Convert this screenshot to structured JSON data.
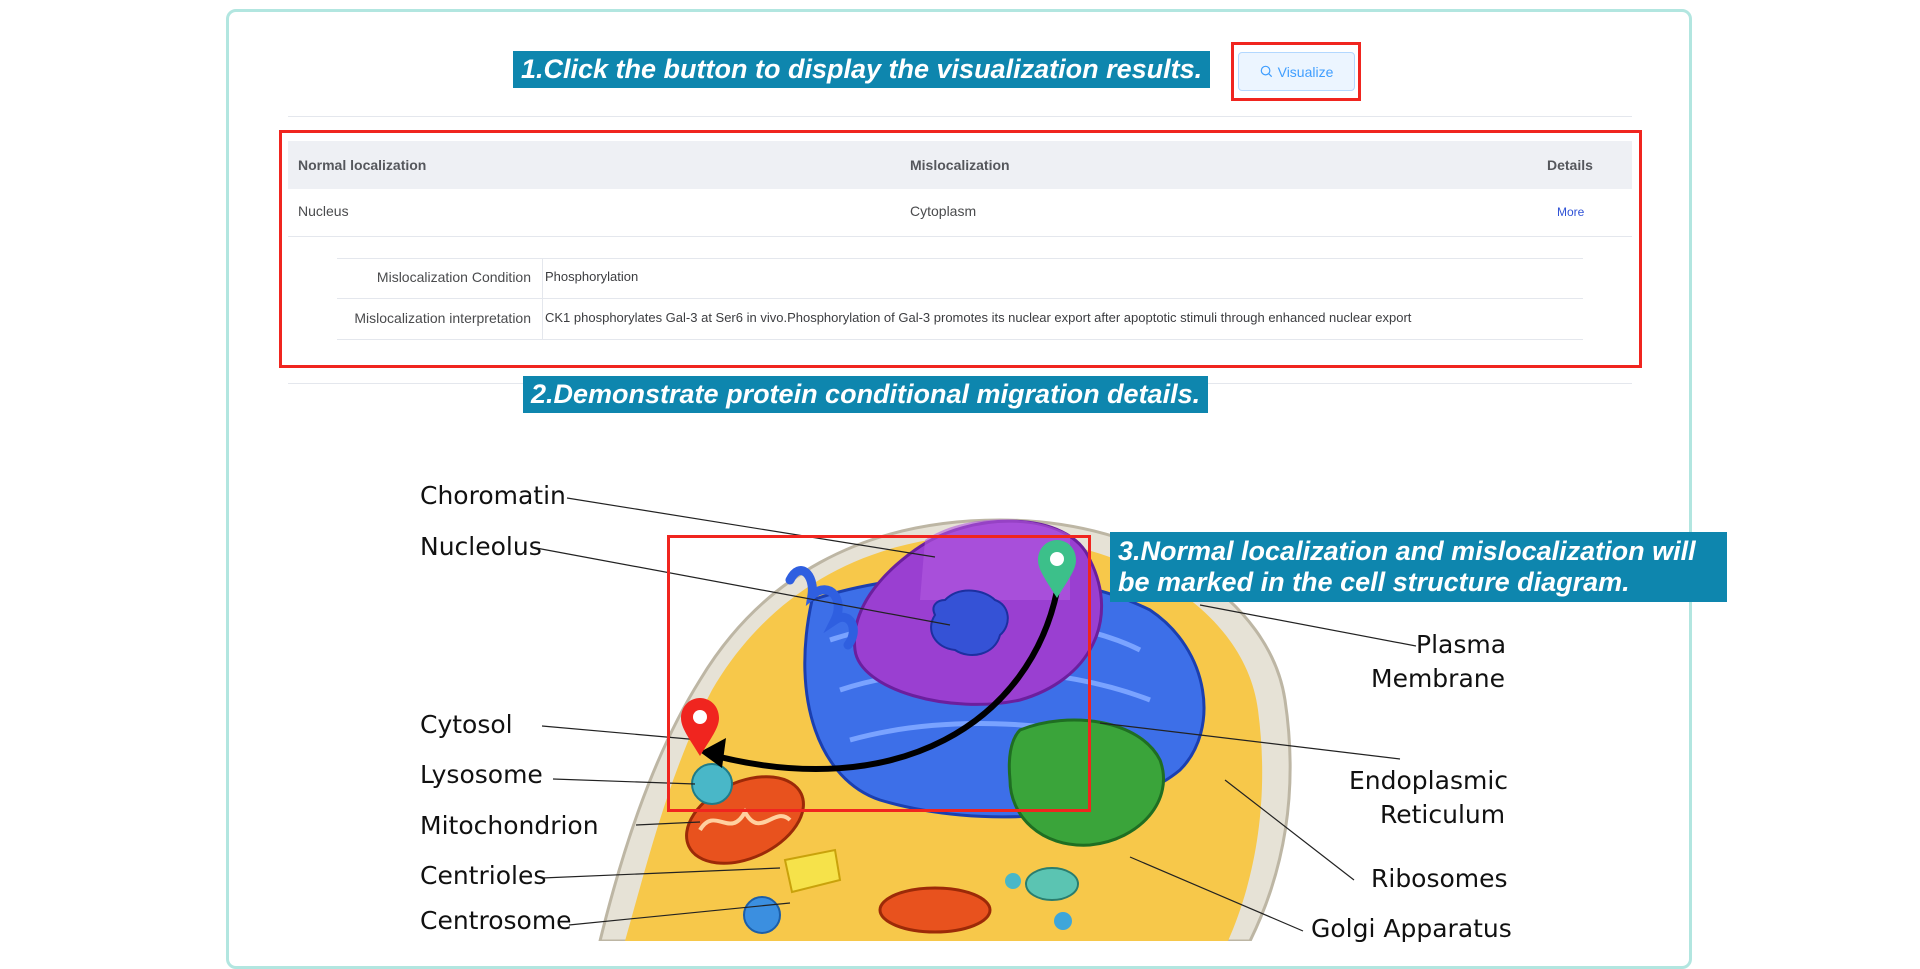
{
  "steps": {
    "step1": "1.Click the button to display the visualization results.",
    "step2": "2.Demonstrate protein conditional migration details.",
    "step3": "3.Normal localization and mislocalization will be marked in the cell structure diagram."
  },
  "visualize_button": {
    "label": "Visualize",
    "icon": "search-icon"
  },
  "table": {
    "headers": [
      "Normal localization",
      "Mislocalization",
      "Details"
    ],
    "row": {
      "normal": "Nucleus",
      "mislocalization": "Cytoplasm",
      "details_link": "More"
    }
  },
  "details": {
    "condition_label": "Mislocalization Condition",
    "condition_value": "Phosphorylation",
    "interpretation_label": "Mislocalization interpretation",
    "interpretation_value": "CK1 phosphorylates Gal-3 at Ser6 in vivo.Phosphorylation of Gal-3 promotes its nuclear export after apoptotic stimuli through enhanced nuclear export"
  },
  "diagram_labels": {
    "choromatin": "Choromatin",
    "nucleolus": "Nucleolus",
    "cytosol": "Cytosol",
    "lysosome": "Lysosome",
    "mitochondrion": "Mitochondrion",
    "centrioles": "Centrioles",
    "centrosome": "Centrosome",
    "plasma_membrane_1": "Plasma",
    "plasma_membrane_2": "Membrane",
    "er_1": "Endoplasmic",
    "er_2": "Reticulum",
    "ribosomes": "Ribosomes",
    "golgi": "Golgi Apparatus"
  },
  "colors": {
    "accent_banner": "#0e86ae",
    "highlight_red": "#f0251f",
    "card_border": "#b2e6e0",
    "normal_marker": "#3cc08a",
    "mislocalization_marker": "#f0251f"
  }
}
